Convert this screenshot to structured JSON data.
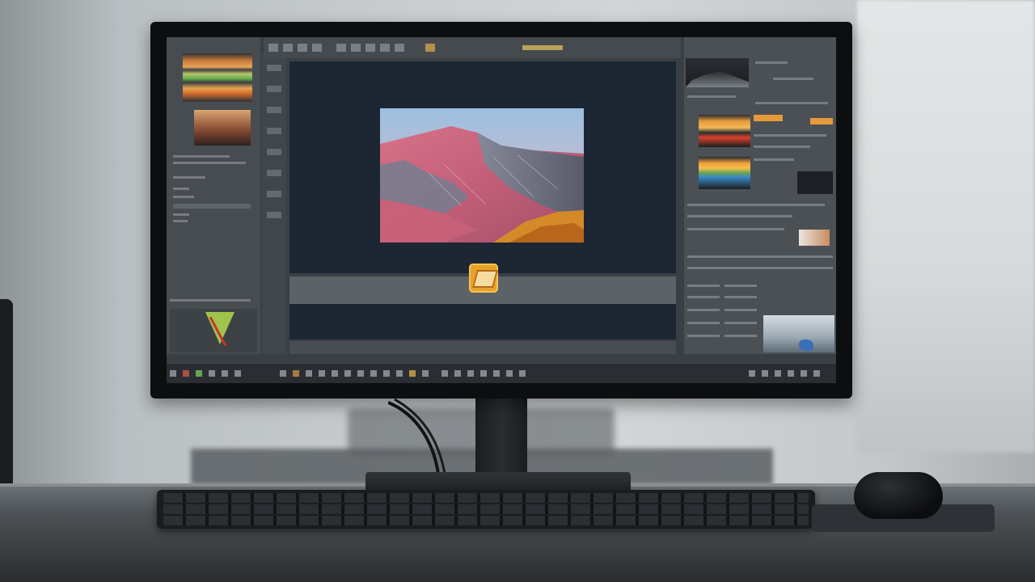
{
  "scene": {
    "description_tags": [
      "desk",
      "monitor",
      "keyboard",
      "mouse"
    ],
    "accent_colors": {
      "ui_accent_orange": "#e8a12b",
      "canvas_bg": "#1c2733",
      "panel_bg": "#4a4f54"
    }
  },
  "monitor": {
    "app": {
      "canvas": {
        "photo": {
          "sky_top": "#9cc0e0",
          "sky_bottom": "#e8b8c0",
          "mountain_main": "#c8627a",
          "ridge_shadow": "#6f7f90",
          "foliage": "#d58a2a"
        }
      },
      "icons": [
        "app-launcher-icon"
      ]
    }
  }
}
